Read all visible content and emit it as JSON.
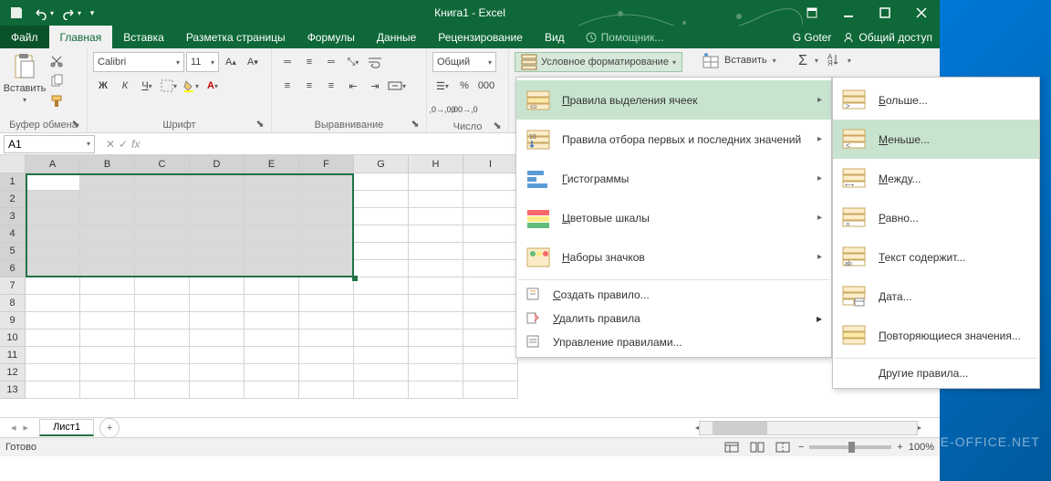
{
  "title": "Книга1 - Excel",
  "user": "G Goter",
  "share": "Общий доступ",
  "helper": "Помощник...",
  "tabs": {
    "file": "Файл",
    "home": "Главная",
    "insert": "Вставка",
    "layout": "Разметка страницы",
    "formulas": "Формулы",
    "data": "Данные",
    "review": "Рецензирование",
    "view": "Вид"
  },
  "ribbon": {
    "clipboard": {
      "paste": "Вставить",
      "label": "Буфер обмена"
    },
    "font": {
      "name": "Calibri",
      "size": "11",
      "label": "Шрифт"
    },
    "alignment": {
      "label": "Выравнивание"
    },
    "number": {
      "format": "Общий",
      "label": "Число"
    },
    "styles": {
      "cond_fmt": "Условное форматирование"
    },
    "cells": {
      "insert": "Вставить"
    }
  },
  "namebox": "A1",
  "columns": [
    "A",
    "B",
    "C",
    "D",
    "E",
    "F",
    "G",
    "H",
    "I"
  ],
  "rows": [
    "1",
    "2",
    "3",
    "4",
    "5",
    "6",
    "7",
    "8",
    "9",
    "10",
    "11",
    "12",
    "13"
  ],
  "selection": {
    "colsSelected": 6,
    "rowsSelected": 6
  },
  "sheet": "Лист1",
  "status": "Готово",
  "zoom": "100%",
  "menu1": {
    "highlight": "Правила выделения ячеек",
    "toprules": "Правила отбора первых и последних значений",
    "databars": "Гистограммы",
    "colorscales": "Цветовые шкалы",
    "iconsets": "Наборы значков",
    "newrule": "Создать правило...",
    "clear": "Удалить правила",
    "manage": "Управление правилами..."
  },
  "menu2": {
    "greater": "Больше...",
    "less": "Меньше...",
    "between": "Между...",
    "equal": "Равно...",
    "textcontains": "Текст содержит...",
    "date": "Дата...",
    "duplicate": "Повторяющиеся значения...",
    "more": "Другие правила..."
  },
  "watermark": "FREE-OFFICE.NET"
}
